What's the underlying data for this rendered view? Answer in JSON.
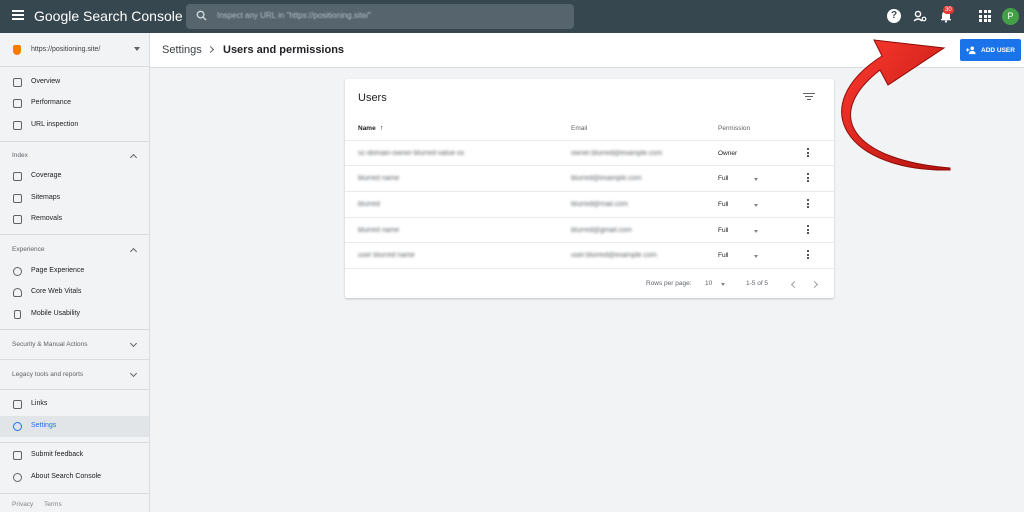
{
  "app": {
    "title": "Google Search Console",
    "avatar_letter": "P",
    "notifications": "30"
  },
  "search": {
    "placeholder": "Inspect any URL in \"https://positioning.site/\""
  },
  "property": {
    "label": "https://positioning.site/"
  },
  "sidebar": {
    "items": [
      {
        "label": "Overview",
        "icon": "home-icon"
      },
      {
        "label": "Performance",
        "icon": "trending-up-icon"
      },
      {
        "label": "URL inspection",
        "icon": "search-icon"
      }
    ],
    "sections": {
      "index": "Index",
      "experience": "Experience",
      "security": "Security & Manual Actions",
      "legacy": "Legacy tools and reports"
    },
    "index_items": [
      {
        "label": "Coverage",
        "icon": "file-copy-icon"
      },
      {
        "label": "Sitemaps",
        "icon": "sitemap-icon"
      },
      {
        "label": "Removals",
        "icon": "visibility-off-icon"
      }
    ],
    "experience_items": [
      {
        "label": "Page Experience",
        "icon": "add-circle-icon"
      },
      {
        "label": "Core Web Vitals",
        "icon": "speed-icon"
      },
      {
        "label": "Mobile Usability",
        "icon": "smartphone-icon"
      }
    ],
    "bottom_items": [
      {
        "label": "Links",
        "icon": "links-icon"
      },
      {
        "label": "Settings",
        "icon": "settings-icon"
      },
      {
        "label": "Submit feedback",
        "icon": "feedback-icon"
      },
      {
        "label": "About Search Console",
        "icon": "info-icon"
      }
    ],
    "footer": {
      "privacy": "Privacy",
      "terms": "Terms"
    }
  },
  "header": {
    "breadcrumb_parent": "Settings",
    "breadcrumb_current": "Users and permissions",
    "add_user_label": "ADD USER"
  },
  "users_card": {
    "title": "Users",
    "columns": {
      "name": "Name",
      "email": "Email",
      "permission": "Permission"
    },
    "rows": [
      {
        "name": "sc-domain-owner-blurred-value-xx",
        "email": "owner.blurred@example.com",
        "permission": "Owner"
      },
      {
        "name": "blurred name",
        "email": "blurred@example.com",
        "permission": "Full"
      },
      {
        "name": "blurred",
        "email": "blurred@mail.com",
        "permission": "Full"
      },
      {
        "name": "blurred name",
        "email": "blurred@gmail.com",
        "permission": "Full"
      },
      {
        "name": "user blurred name",
        "email": "user.blurred@example.com",
        "permission": "Full"
      }
    ],
    "pager": {
      "rows_per_page_label": "Rows per page:",
      "rows_per_page": "10",
      "range": "1-5 of 5"
    }
  },
  "colors": {
    "topbar": "#37474f",
    "accent": "#1a73e8",
    "arrow": "#e0201c"
  }
}
